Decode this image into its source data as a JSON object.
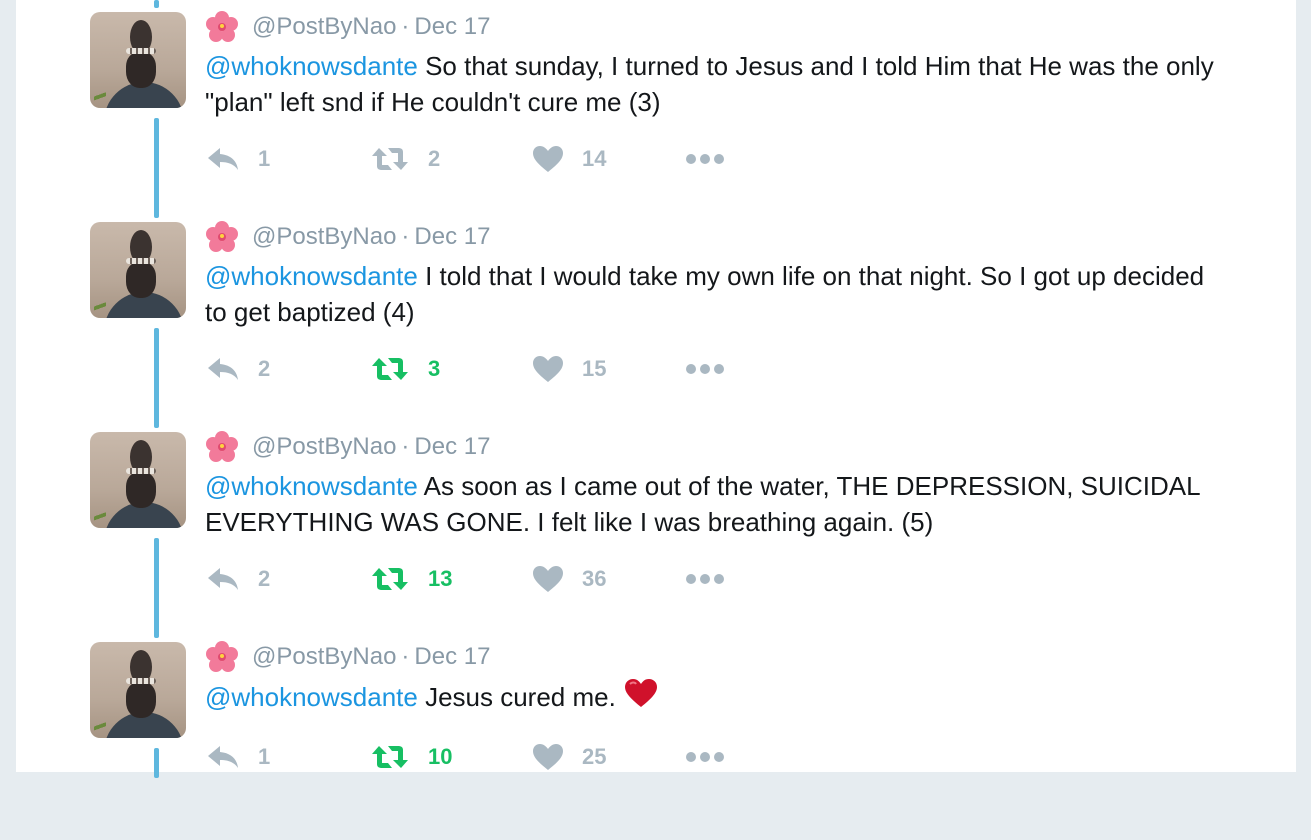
{
  "tweets": [
    {
      "handle": "@PostByNao",
      "separator": "·",
      "date": "Dec 17",
      "mention": "@whoknowsdante",
      "body": " So that sunday, I turned to Jesus and I told Him that He was the only \"plan\" left snd if He couldn't cure me (3)",
      "replies": "1",
      "retweets": "2",
      "likes": "14",
      "retweeted": false
    },
    {
      "handle": "@PostByNao",
      "separator": "·",
      "date": "Dec 17",
      "mention": "@whoknowsdante",
      "body": " I told that I would take my own life on that night. So I got up decided to get baptized (4)",
      "replies": "2",
      "retweets": "3",
      "likes": "15",
      "retweeted": true
    },
    {
      "handle": "@PostByNao",
      "separator": "·",
      "date": "Dec 17",
      "mention": "@whoknowsdante",
      "body": " As soon as I came out of the water, THE DEPRESSION, SUICIDAL EVERYTHING WAS GONE. I felt like I was breathing again. (5)",
      "replies": "2",
      "retweets": "13",
      "likes": "36",
      "retweeted": true
    },
    {
      "handle": "@PostByNao",
      "separator": "·",
      "date": "Dec 17",
      "mention": "@whoknowsdante",
      "body": " Jesus cured me.",
      "replies": "1",
      "retweets": "10",
      "likes": "25",
      "retweeted": true,
      "emoji": "red-heart"
    }
  ],
  "colors": {
    "mention": "#1b95e0",
    "muted": "#8899a6",
    "icon": "#aab8c2",
    "retweet_active": "#17bf63",
    "thread_line": "#5eb7de"
  },
  "icons": {
    "reply": "reply-icon",
    "retweet": "retweet-icon",
    "like": "heart-icon",
    "more": "more-icon",
    "flower": "hibiscus-icon"
  }
}
